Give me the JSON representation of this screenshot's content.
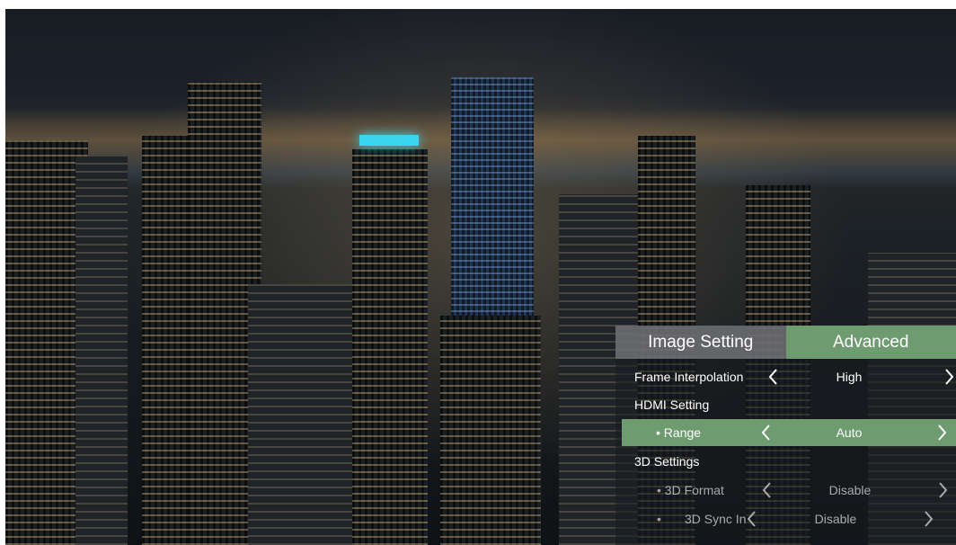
{
  "menu": {
    "tabs": [
      {
        "label": "Image Setting"
      },
      {
        "label": "Advanced"
      }
    ],
    "rows": {
      "frame_interpolation": {
        "label": "Frame Interpolation",
        "value": "High"
      },
      "hdmi_setting": {
        "label": "HDMI Setting"
      },
      "range": {
        "label": "• Range",
        "value": "Auto"
      },
      "settings_3d": {
        "label": "3D Settings"
      },
      "format_3d": {
        "label": "• 3D Format",
        "value": "Disable"
      },
      "sync_3d": {
        "bullet": "•",
        "label": "3D Sync In",
        "value": "Disable"
      }
    },
    "colors": {
      "accent": "#6e9b70",
      "tab_inactive": "#787a7e"
    },
    "icons": {
      "prev": "chevron-left-icon",
      "next": "chevron-right-icon"
    }
  }
}
